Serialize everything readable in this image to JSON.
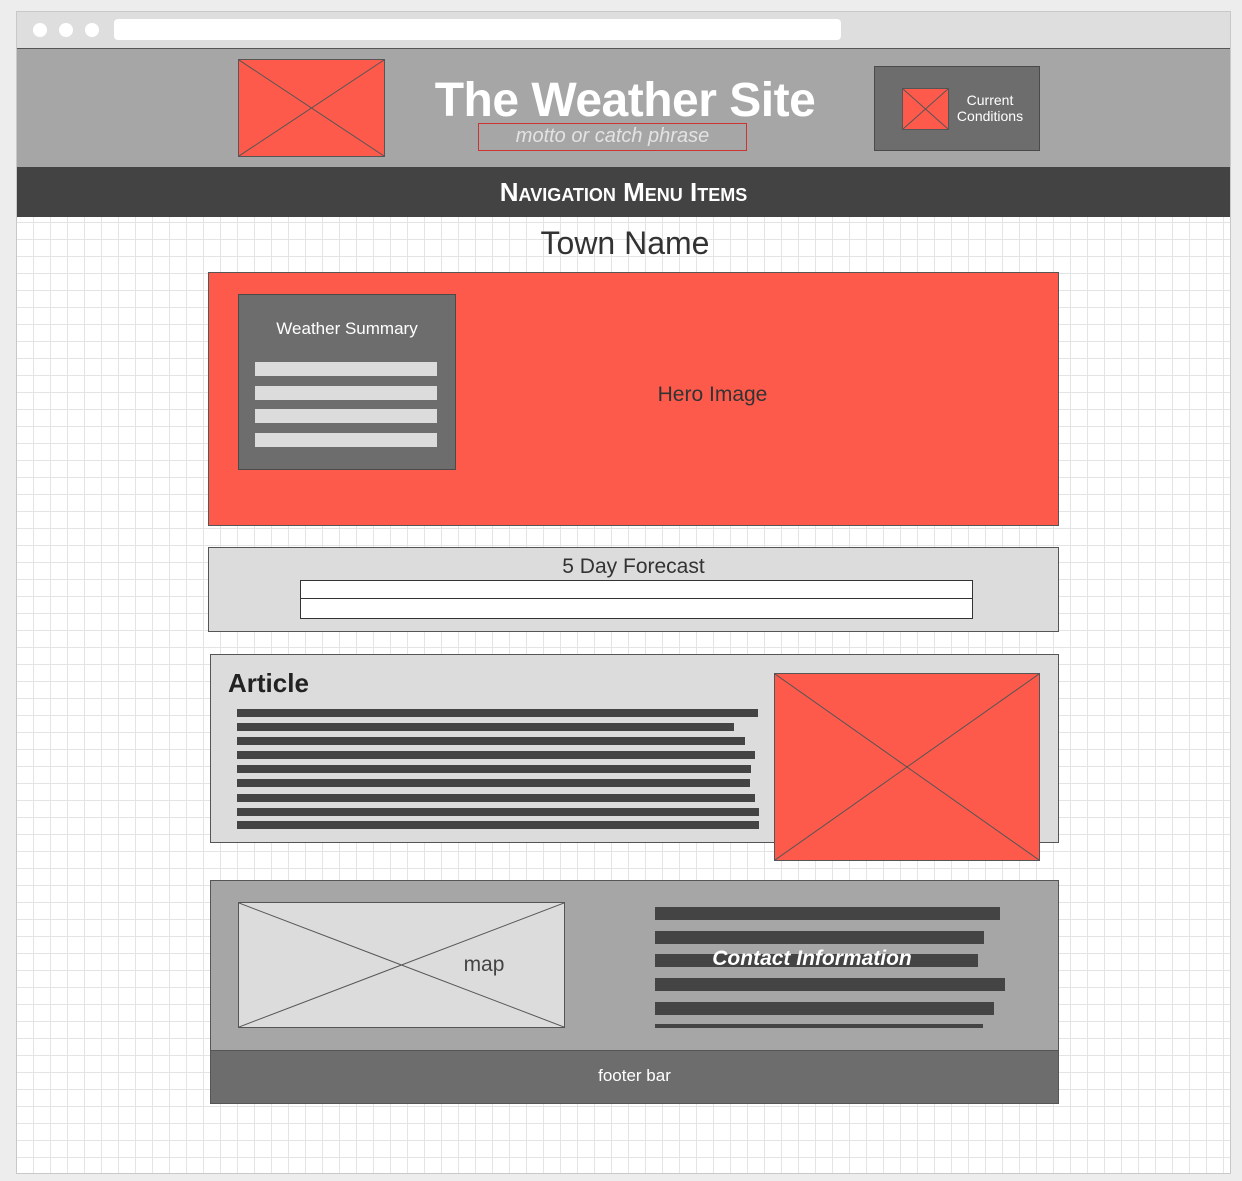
{
  "header": {
    "site_title": "The Weather Site",
    "motto": "motto or catch phrase",
    "current_conditions": "Current Conditions"
  },
  "nav": {
    "label": "Navigation Menu Items"
  },
  "page": {
    "town_name": "Town Name"
  },
  "hero": {
    "label": "Hero Image",
    "summary_title": "Weather Summary"
  },
  "forecast": {
    "title": "5 Day Forecast"
  },
  "article": {
    "title": "Article"
  },
  "contact": {
    "map_label": "map",
    "title": "Contact Information"
  },
  "footer": {
    "label": "footer bar"
  },
  "colors": {
    "placeholder_red": "#fe5a4c",
    "header_gray": "#a6a6a6",
    "nav_dark": "#434343",
    "panel_dark": "#6d6d6d",
    "panel_light": "#dcdcdc"
  }
}
